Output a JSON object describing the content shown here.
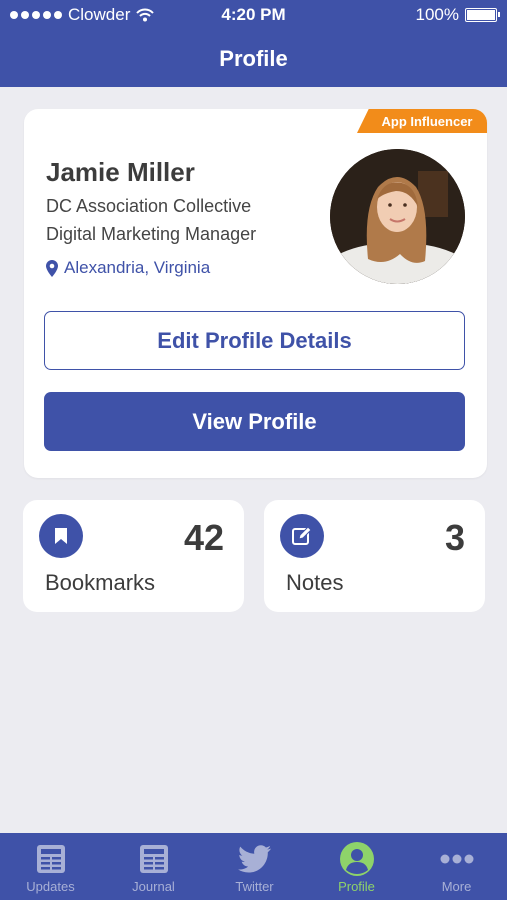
{
  "status_bar": {
    "carrier": "Clowder",
    "time": "4:20 PM",
    "battery": "100%"
  },
  "nav": {
    "title": "Profile"
  },
  "profile": {
    "badge": "App Influencer",
    "name": "Jamie Miller",
    "organization": "DC Association Collective",
    "role": "Digital Marketing Manager",
    "location": "Alexandria, Virginia",
    "edit_button": "Edit Profile Details",
    "view_button": "View Profile"
  },
  "stats": {
    "bookmarks": {
      "count": "42",
      "label": "Bookmarks"
    },
    "notes": {
      "count": "3",
      "label": "Notes"
    }
  },
  "tabs": [
    {
      "label": "Updates",
      "icon": "news-icon",
      "active": false
    },
    {
      "label": "Journal",
      "icon": "news-icon",
      "active": false
    },
    {
      "label": "Twitter",
      "icon": "twitter-icon",
      "active": false
    },
    {
      "label": "Profile",
      "icon": "user-icon",
      "active": true
    },
    {
      "label": "More",
      "icon": "ellipsis-icon",
      "active": false
    }
  ],
  "colors": {
    "brand": "#3f52a8",
    "accent": "#f28c1a",
    "active_tab": "#8ed36a",
    "background": "#ececf1"
  }
}
